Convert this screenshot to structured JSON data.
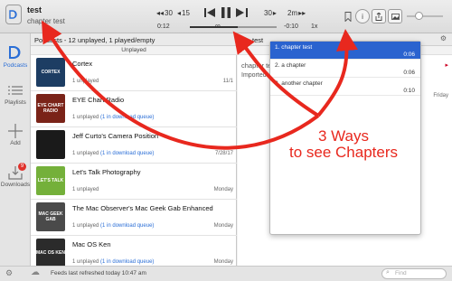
{
  "player": {
    "episode_title": "test",
    "episode_subtitle": "chapter test",
    "skip_back_30": "30",
    "skip_back_15": "15",
    "skip_fwd_30": "30",
    "skip_fwd_2m": "2m",
    "elapsed": "0:12",
    "remaining": "-0:10",
    "speed": "1x",
    "progress_fraction": 0.55,
    "volume_fraction": 0.25
  },
  "sidebar": {
    "items": [
      {
        "label": "Podcasts",
        "icon": "podcast-icon",
        "active": true
      },
      {
        "label": "Playlists",
        "icon": "playlist-icon",
        "active": false
      },
      {
        "label": "Add",
        "icon": "plus-icon",
        "active": false
      },
      {
        "label": "Downloads",
        "icon": "download-icon",
        "active": false,
        "badge": "9"
      }
    ]
  },
  "podcasts": {
    "header": "Podcasts - 12 unplayed, 1 played/empty",
    "section": "Unplayed",
    "rows": [
      {
        "name": "Cortex",
        "meta_prefix": "1 unplayed",
        "queue": "",
        "date": "11/1",
        "art_color": "#1d3d63",
        "art_text": "CORTEX"
      },
      {
        "name": "EYE Chart Radio",
        "meta_prefix": "1 unplayed",
        "queue": "(1 in download queue)",
        "date": "",
        "art_color": "#7a2318",
        "art_text": "EYE CHART RADIO"
      },
      {
        "name": "Jeff Curto's Camera Position",
        "meta_prefix": "1 unplayed",
        "queue": "(1 in download queue)",
        "date": "7/28/17",
        "art_color": "#1a1a1a",
        "art_text": ""
      },
      {
        "name": "Let's Talk Photography",
        "meta_prefix": "1 unplayed",
        "queue": "",
        "date": "Monday",
        "art_color": "#74b03a",
        "art_text": "LET'S TALK"
      },
      {
        "name": "The Mac Observer's Mac Geek Gab Enhanced",
        "meta_prefix": "1 unplayed",
        "queue": "(1 in download queue)",
        "date": "Monday",
        "art_color": "#4a4a4a",
        "art_text": "MAC GEEK GAB"
      },
      {
        "name": "Mac OS Ken",
        "meta_prefix": "1 unplayed",
        "queue": "(1 in download queue)",
        "date": "Monday",
        "art_color": "#2b2b2b",
        "art_text": "MAC OS KEN"
      }
    ]
  },
  "episodes": {
    "toolbar_title": "test",
    "item_title": "chapter test",
    "item_meta": "Imported",
    "item_date": "Friday"
  },
  "chapters": {
    "items": [
      {
        "index": "1.",
        "title": "chapter test",
        "time": "0:06",
        "selected": true
      },
      {
        "index": "2.",
        "title": "a chapter",
        "time": "0:06",
        "selected": false
      },
      {
        "index": "3.",
        "title": "another chapter",
        "time": "0:10",
        "selected": false
      }
    ]
  },
  "status": {
    "text": "Feeds last refreshed today 10:47 am",
    "find_placeholder": "Find"
  },
  "annotation": {
    "line1": "3 Ways",
    "line2": "to see Chapters",
    "color": "#e8281e"
  }
}
